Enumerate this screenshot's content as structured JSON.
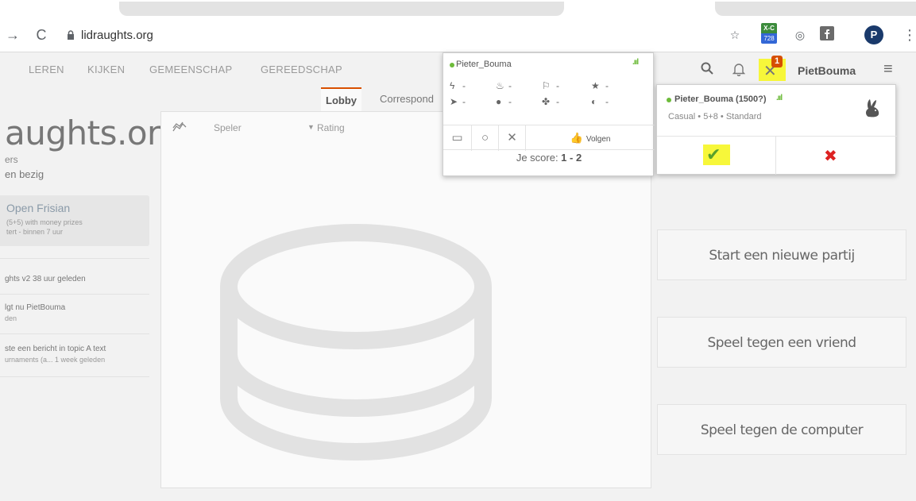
{
  "browser": {
    "url": "lidraughts.org",
    "ext_badge_top": "X-C",
    "ext_badge_count": "728",
    "profile_initial": "P"
  },
  "nav": {
    "items": [
      "LEREN",
      "KIJKEN",
      "GEMEENSCHAP",
      "GEREEDSCHAP"
    ],
    "user": "PietBouma",
    "challenge_count": "1"
  },
  "sidebar": {
    "logo": "aughts.org",
    "players": "ers",
    "games": "en bezig",
    "tournament": {
      "title": "Open Frisian",
      "line1": "(5+5) with money prizes",
      "line2": "tert -  binnen 7 uur"
    },
    "timeline": [
      {
        "text": "ghts v2 38 uur geleden",
        "sub": ""
      },
      {
        "text": "lgt nu PietBouma",
        "sub": "den"
      },
      {
        "text": "ste een bericht in topic A text",
        "sub": "urnaments (a... 1 week geleden"
      }
    ]
  },
  "lobby": {
    "tabs": [
      "Lobby",
      "Correspond"
    ],
    "col_player": "Speler",
    "col_rating": "Rating"
  },
  "player_popup": {
    "name": "Pieter_Bouma",
    "stats": [
      "-",
      "-",
      "-",
      "-",
      "-",
      "-",
      "-",
      "-"
    ],
    "follow_label": "Volgen",
    "score_prefix": "Je score: ",
    "score_value": "1 - 2"
  },
  "challenge_popup": {
    "name": "Pieter_Bouma (1500?)",
    "description": "Casual • 5+8 • Standard"
  },
  "actions": {
    "new_game": "Start een nieuwe partij",
    "vs_friend": "Speel tegen een vriend",
    "vs_computer": "Speel tegen de computer"
  },
  "colors": {
    "accent": "#d85000",
    "highlight": "#f7f73a",
    "online": "#6dbb3a",
    "decline": "#dd2222"
  }
}
